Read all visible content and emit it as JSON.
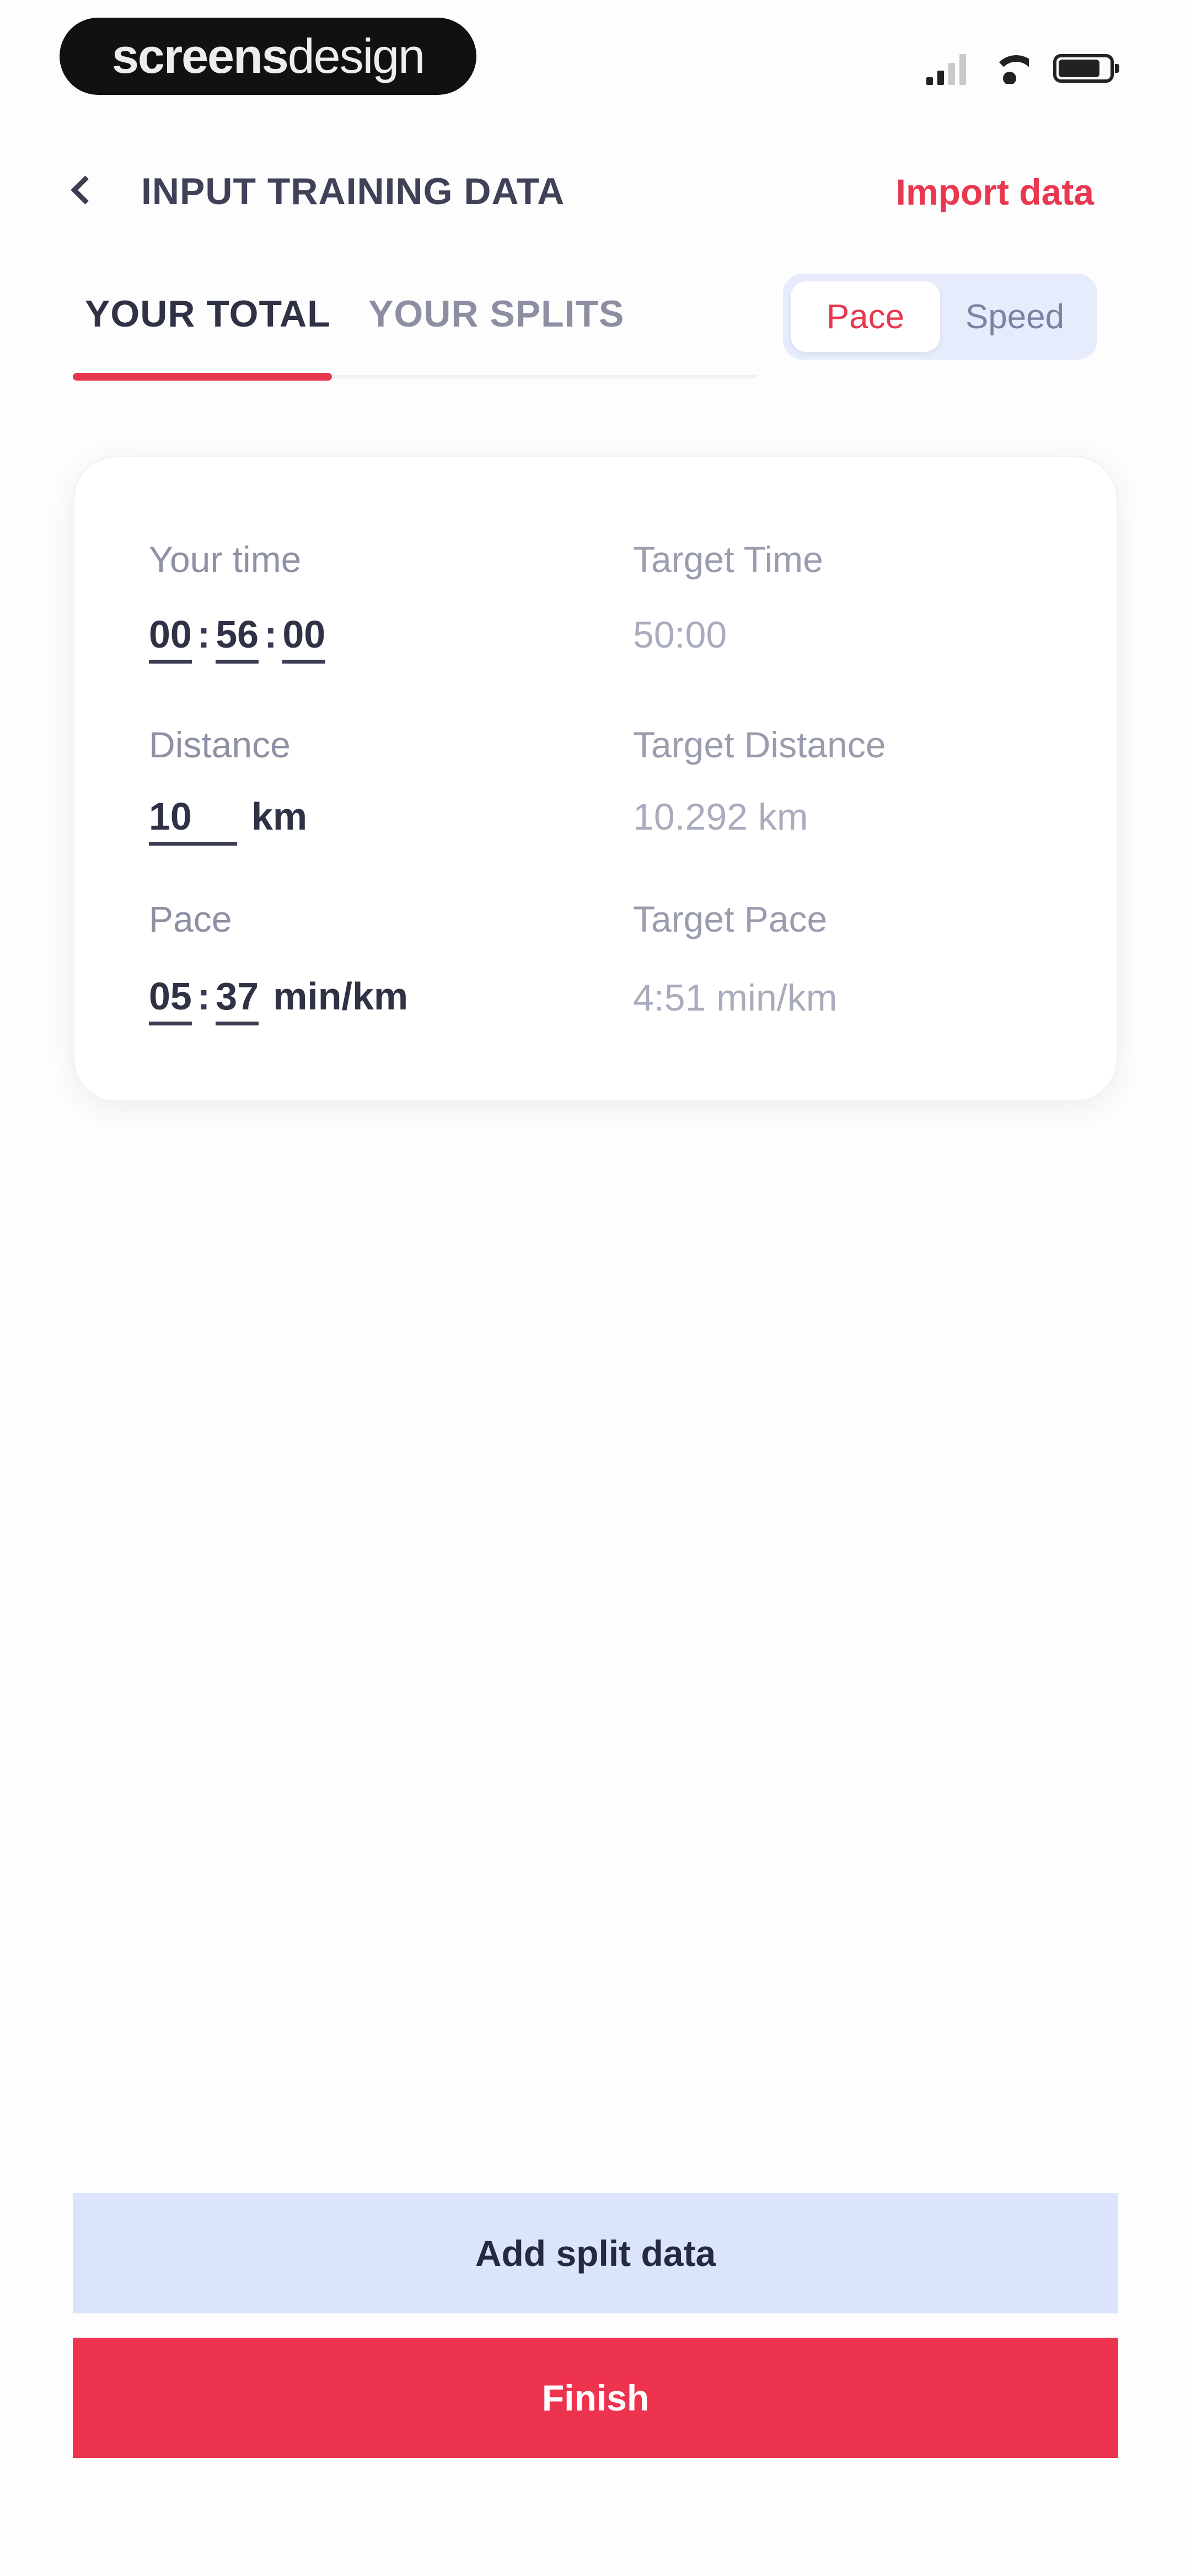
{
  "status_bar": {
    "brand_bold": "screens",
    "brand_light": "design"
  },
  "header": {
    "title": "INPUT TRAINING DATA",
    "import_label": "Import data"
  },
  "tabs": [
    {
      "label": "YOUR TOTAL",
      "active": true
    },
    {
      "label": "YOUR SPLITS",
      "active": false
    }
  ],
  "mode_toggle": {
    "options": [
      "Pace",
      "Speed"
    ],
    "selected": "Pace"
  },
  "card": {
    "your_time": {
      "label": "Your time",
      "hours": "00",
      "minutes": "56",
      "seconds": "00"
    },
    "target_time": {
      "label": "Target Time",
      "value": "50:00"
    },
    "distance": {
      "label": "Distance",
      "value": "10",
      "unit": "km"
    },
    "target_distance": {
      "label": "Target Distance",
      "value": "10.292 km"
    },
    "pace": {
      "label": "Pace",
      "minutes": "05",
      "seconds": "37",
      "unit": "min/km"
    },
    "target_pace": {
      "label": "Target Pace",
      "value": "4:51 min/km"
    }
  },
  "buttons": {
    "add_split": "Add split data",
    "finish": "Finish"
  },
  "colors": {
    "accent": "#E8384F",
    "secondary_button": "#DAE4FA",
    "text_dark": "#2F3245"
  }
}
